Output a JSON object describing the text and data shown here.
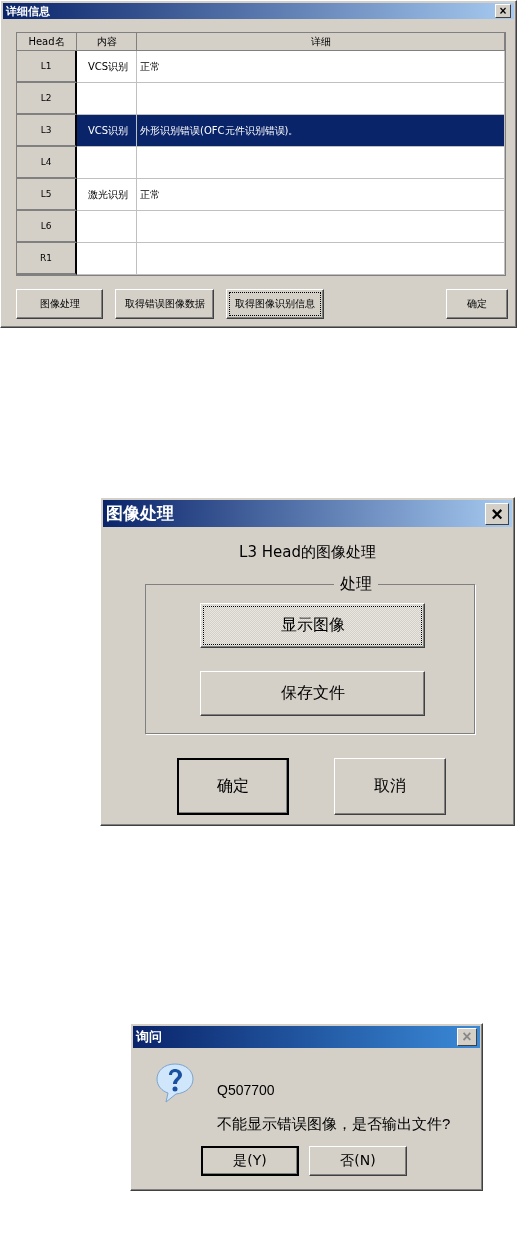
{
  "detail_dialog": {
    "title": "详细信息",
    "close": "×",
    "columns": [
      "Head名",
      "内容",
      "详细"
    ],
    "rows": [
      {
        "head": "L1",
        "content": "VCS识别",
        "detail": "正常",
        "selected": false
      },
      {
        "head": "L2",
        "selected": false
      },
      {
        "head": "L3",
        "content": "VCS识别",
        "detail": "外形识别错误(OFC元件识别错误)。",
        "selected": true
      },
      {
        "head": "L4",
        "selected": false
      },
      {
        "head": "L5",
        "content": "激光识别",
        "detail": "正常",
        "selected": false
      },
      {
        "head": "L6",
        "selected": false
      },
      {
        "head": "R1",
        "selected": false
      }
    ],
    "buttons": [
      {
        "label": "图像处理",
        "focused": false
      },
      {
        "label": "取得错误图像数据",
        "focused": false
      },
      {
        "label": "取得图像识别信息",
        "focused": true
      }
    ],
    "ok_button": "确定"
  },
  "image_dialog": {
    "title": "图像处理",
    "close": "×",
    "heading": "L3 Head的图像处理",
    "group_label": "处理",
    "actions": [
      {
        "label": "显示图像",
        "focused": true
      },
      {
        "label": "保存文件",
        "focused": false
      }
    ],
    "buttons": [
      {
        "label": "确定",
        "default": true
      },
      {
        "label": "取消",
        "default": false
      }
    ]
  },
  "query_dialog": {
    "title": "询问",
    "close": "×",
    "code": "Q507700",
    "message": "不能显示错误图像，是否输出文件?",
    "buttons": [
      {
        "label": "是(Y)",
        "default": true
      },
      {
        "label": "否(N)",
        "default": false
      }
    ]
  }
}
